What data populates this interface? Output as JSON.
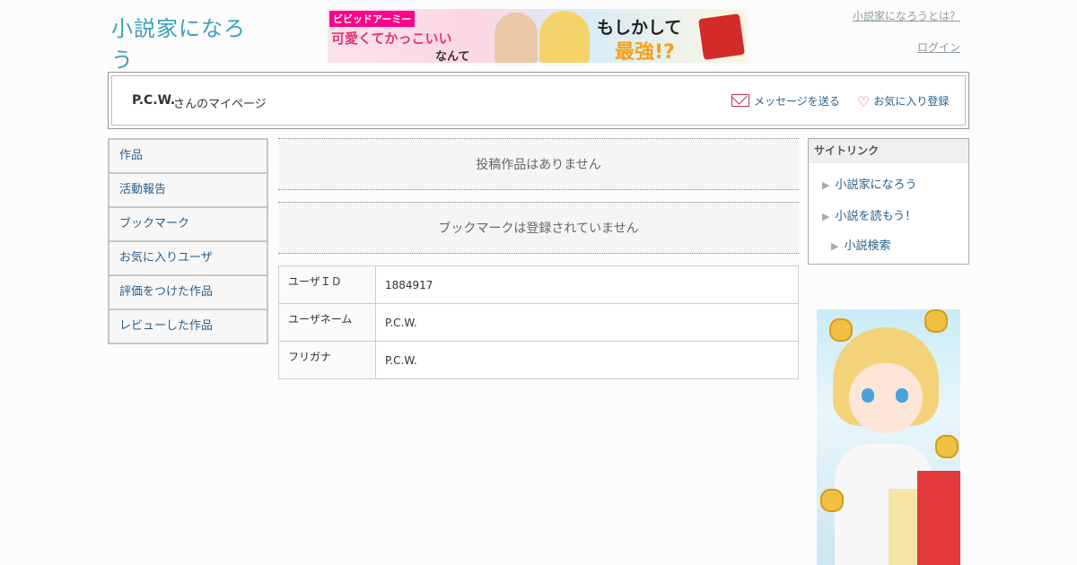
{
  "header": {
    "logo_text": "小説家になろう",
    "links": {
      "about": "小説家になろうとは？",
      "login": "ログイン"
    }
  },
  "top_banner": {
    "brand": "ビビッドアーミー",
    "line1": "可愛くてかっこいい",
    "line2": "なんて",
    "line3": "もしかして",
    "line4": "最強!?"
  },
  "userbox": {
    "username": "P.C.W.",
    "suffix": "さんのマイページ",
    "message_label": "メッセージを送る",
    "favorite_label": "お気に入り登録"
  },
  "sidenav": {
    "items": [
      "作品",
      "活動報告",
      "ブックマーク",
      "お気に入りユーザ",
      "評価をつけた作品",
      "レビューした作品"
    ]
  },
  "main": {
    "no_works": "投稿作品はありません",
    "no_bookmarks": "ブックマークは登録されていません",
    "profile": [
      {
        "key": "ユーザＩＤ",
        "value": "1884917"
      },
      {
        "key": "ユーザネーム",
        "value": "P.C.W."
      },
      {
        "key": "フリガナ",
        "value": "P.C.W."
      }
    ]
  },
  "sitelink": {
    "title": "サイトリンク",
    "items": [
      "小説家になろう",
      "小説を読もう！",
      "小説検索"
    ]
  },
  "colors": {
    "link": "#2a5f8a",
    "logo": "#3aa0bd"
  },
  "icons": {
    "message": "envelope-icon",
    "favorite": "heart-icon",
    "sitelink_bullet": "triangle-right-icon"
  }
}
